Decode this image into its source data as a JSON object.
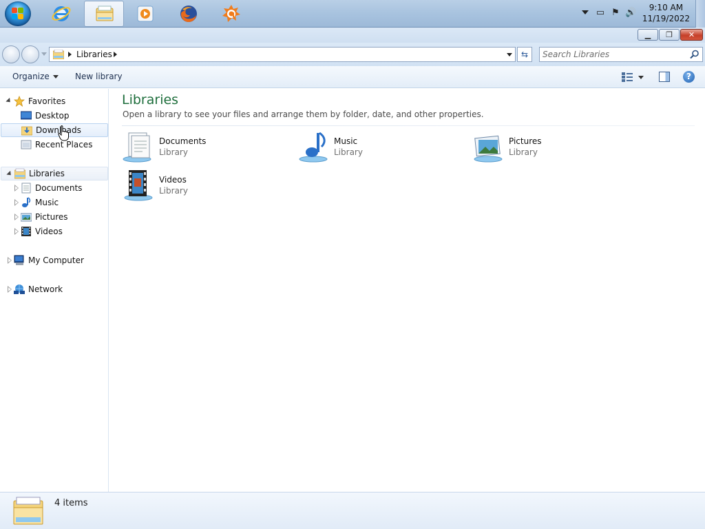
{
  "taskbar": {
    "clock_time": "9:10 AM",
    "clock_date": "11/19/2022",
    "apps": [
      {
        "name": "internet-explorer-icon"
      },
      {
        "name": "windows-explorer-icon"
      },
      {
        "name": "media-player-icon"
      },
      {
        "name": "firefox-icon"
      },
      {
        "name": "avast-icon"
      }
    ]
  },
  "address": {
    "crumb": "Libraries",
    "search_placeholder": "Search Libraries"
  },
  "toolbar": {
    "organize": "Organize",
    "new_library": "New library"
  },
  "nav": {
    "favorites": "Favorites",
    "desktop": "Desktop",
    "downloads": "Downloads",
    "recent_places": "Recent Places",
    "libraries": "Libraries",
    "documents": "Documents",
    "music": "Music",
    "pictures": "Pictures",
    "videos": "Videos",
    "my_computer": "My Computer",
    "network": "Network"
  },
  "content": {
    "title": "Libraries",
    "description": "Open a library to see your files and arrange them by folder, date, and other properties.",
    "libraries": [
      {
        "name": "Documents",
        "type": "Library"
      },
      {
        "name": "Music",
        "type": "Library"
      },
      {
        "name": "Pictures",
        "type": "Library"
      },
      {
        "name": "Videos",
        "type": "Library"
      }
    ]
  },
  "status": {
    "count": "4 items"
  },
  "colors": {
    "title_green": "#1e6e3c",
    "accent_blue": "#3aa0e6"
  }
}
